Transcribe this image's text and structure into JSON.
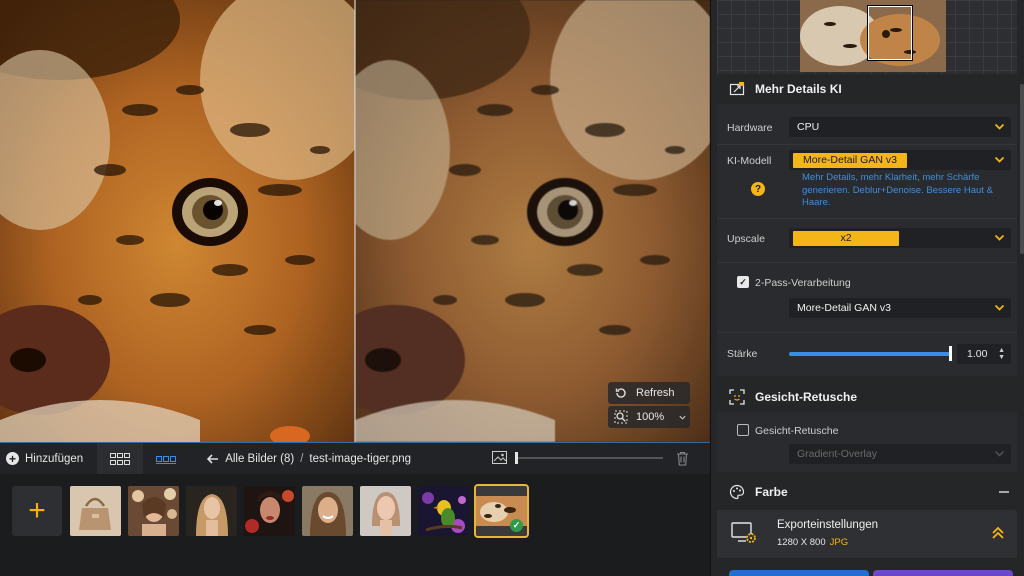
{
  "preview": {
    "refresh_label": "Refresh",
    "zoom_label": "100%"
  },
  "toolbar": {
    "add_label": "Hinzufügen",
    "breadcrumb_all": "Alle Bilder (8)",
    "breadcrumb_sep": "/",
    "breadcrumb_file": "test-image-tiger.png"
  },
  "thumbnails": [
    {
      "name": "handbag",
      "selected": false
    },
    {
      "name": "woman-flowers",
      "selected": false
    },
    {
      "name": "woman-blonde",
      "selected": false
    },
    {
      "name": "woman-dark",
      "selected": false
    },
    {
      "name": "woman-smiling",
      "selected": false
    },
    {
      "name": "woman-portrait",
      "selected": false
    },
    {
      "name": "bird",
      "selected": false
    },
    {
      "name": "tiger",
      "selected": true
    }
  ],
  "panel": {
    "details": {
      "title": "Mehr Details KI",
      "hardware_label": "Hardware",
      "hardware_value": "CPU",
      "model_label": "KI-Modell",
      "model_value": "More-Detail GAN  v3",
      "model_desc": "Mehr Details, mehr Klarheit, mehr Schärfe generieren. Deblur+Denoise. Bessere Haut & Haare.",
      "help_glyph": "?",
      "upscale_label": "Upscale",
      "upscale_value": "x2",
      "twopass_label": "2-Pass-Verarbeitung",
      "twopass_checked": true,
      "twopass_model": "More-Detail GAN  v3",
      "strength_label": "Stärke",
      "strength_value": "1.00",
      "strength_fraction": 1.0
    },
    "face": {
      "title": "Gesicht-Retusche",
      "checkbox_label": "Gesicht-Retusche",
      "checked": false,
      "overlay_value": "Gradient-Overlay"
    },
    "color": {
      "title": "Farbe"
    },
    "export": {
      "title": "Exporteinstellungen",
      "resolution": "1280 X 800",
      "format": "JPG"
    }
  },
  "colors": {
    "accent": "#f3b517",
    "link": "#3d8fe0",
    "slider": "#3b8de8",
    "selection_border": "#e8b43a"
  }
}
